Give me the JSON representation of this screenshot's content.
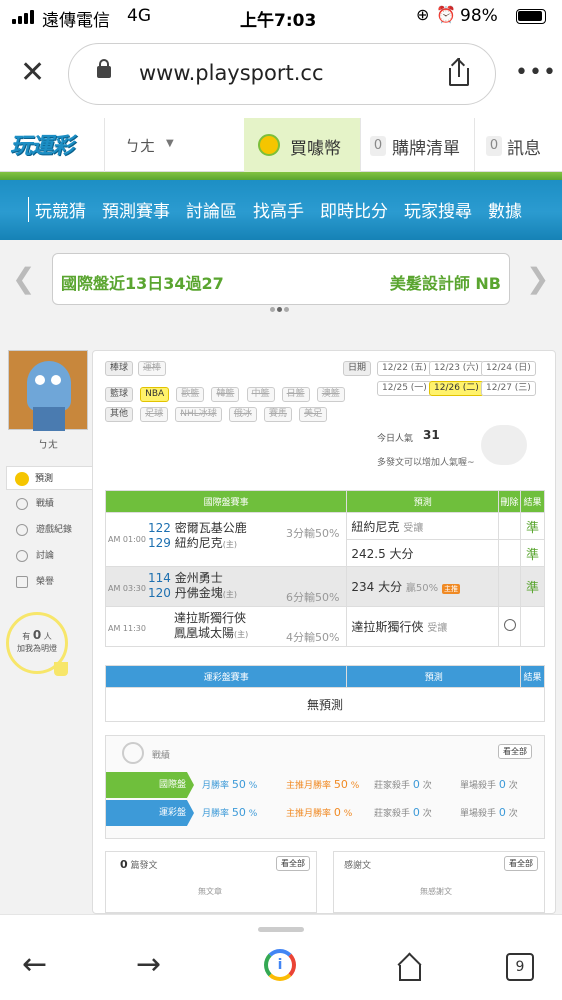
{
  "status_bar": {
    "carrier": "遠傳電信",
    "network": "4G",
    "time": "上午7:03",
    "battery": "98%"
  },
  "browser": {
    "url": "www.playsport.cc",
    "tabs_count": "9"
  },
  "site_header": {
    "logo": "玩運彩",
    "user_initial": "ㄅㄤ",
    "buy_coins": "買噱幣",
    "purchase_count": "0",
    "purchase_label": "購牌清單",
    "msg_count": "0",
    "msg_label": "訊息"
  },
  "nav": {
    "items": [
      "玩競猜",
      "預測賽事",
      "討論區",
      "找高手",
      "即時比分",
      "玩家搜尋",
      "數據"
    ]
  },
  "banner": {
    "left_text": "國際盤近13日34過27",
    "right_text": "美髮設計師 NB"
  },
  "profile": {
    "name": "ㄅㄤ",
    "side_items": [
      "預測",
      "戰績",
      "遊戲紀錄",
      "討論",
      "榮譽"
    ],
    "fans_prefix": "有",
    "fans_count": "0",
    "fans_unit": "人",
    "fans_note": "加我為明燈"
  },
  "filters": {
    "baseball_label": "棒球",
    "baseball_items": [
      "運棒"
    ],
    "basketball_label": "籃球",
    "basketball_items": [
      "NBA",
      "歐籃",
      "韓籃",
      "中籃",
      "日籃",
      "澳籃"
    ],
    "other_label": "其他",
    "other_items": [
      "足球",
      "NHL冰球",
      "俄冰",
      "賽馬",
      "美足"
    ],
    "date_label": "日期",
    "dates": [
      "12/22 (五)",
      "12/23 (六)",
      "12/24 (日)",
      "12/25 (一)",
      "12/26 (二)",
      "12/27 (三)"
    ],
    "popularity_label": "今日人氣",
    "popularity_value": "31",
    "popularity_note": "多發文可以增加人氣喔~"
  },
  "intl_table": {
    "headers": [
      "國際盤賽事",
      "預測",
      "刪除",
      "結果"
    ],
    "games": [
      {
        "time": "AM 01:00",
        "away_no": "122",
        "away": "密爾瓦基公鹿",
        "home_no": "129",
        "home": "紐約尼克",
        "spread": "3分輸50%",
        "pick1": "紐約尼克",
        "pick1_sub": "受讓",
        "result1": "準",
        "pick2": "242.5 大分",
        "result2": "準"
      },
      {
        "time": "AM 03:30",
        "away_no": "114",
        "away": "金州勇士",
        "home_no": "120",
        "home": "丹佛金塊",
        "spread": "6分輸50%",
        "pick1": "234 大分",
        "pick1_sub": "贏50%",
        "badge": "主推",
        "result1": "準"
      },
      {
        "time": "AM 11:30",
        "away_no": "",
        "away": "達拉斯獨行俠",
        "home_no": "",
        "home": "鳳凰城太陽",
        "spread": "4分輸50%",
        "pick1": "達拉斯獨行俠",
        "pick1_sub": "受讓",
        "result1": ""
      }
    ],
    "home_mark": "(主)"
  },
  "lottery_table": {
    "headers": [
      "運彩盤賽事",
      "預測",
      "結果"
    ],
    "empty": "無預測"
  },
  "record": {
    "title": "戰績",
    "view_all": "看全部",
    "rows": [
      {
        "label": "國際盤",
        "c1": "月勝率",
        "v1": "50",
        "u1": "%",
        "c2": "主推月勝率",
        "v2": "50",
        "u2": "%",
        "c3": "莊家殺手",
        "v3": "0",
        "u3": "次",
        "c4": "單場殺手",
        "v4": "0",
        "u4": "次"
      },
      {
        "label": "運彩盤",
        "c1": "月勝率",
        "v1": "50",
        "u1": "%",
        "c2": "主推月勝率",
        "v2": "0",
        "u2": "%",
        "c3": "莊家殺手",
        "v3": "0",
        "u3": "次",
        "c4": "單場殺手",
        "v4": "0",
        "u4": "次"
      }
    ]
  },
  "posts": {
    "count": "0",
    "label": "篇發文",
    "view_all": "看全部",
    "empty": "無文章"
  },
  "thanks": {
    "label": "感謝文",
    "view_all": "看全部",
    "empty": "無感謝文"
  },
  "colors": {
    "green": "#6fbf3c",
    "blue": "#3d9ad8",
    "nav_blue": "#1c8ec4",
    "gold": "#f5c500"
  }
}
